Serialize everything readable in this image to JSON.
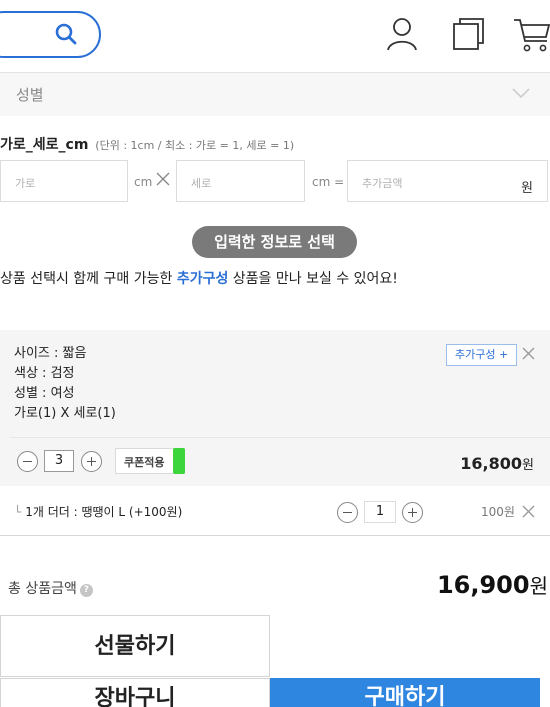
{
  "header": {
    "icons": [
      "search-icon",
      "user-icon",
      "recent-icon",
      "cart-icon"
    ]
  },
  "gender_select": {
    "label": "성별"
  },
  "size_input": {
    "title": "가로_세로_cm",
    "hint": "(단위 : 1cm / 최소 : 가로 = 1, 세로 = 1)",
    "width_placeholder": "가로",
    "height_placeholder": "세로",
    "unit_cm": "cm",
    "unit_cm_eq": "cm =",
    "price_placeholder": "추가금액",
    "won": "원"
  },
  "select_button": "입력한 정보로 선택",
  "notice": {
    "before": "상품 선택시 함께 구매 가능한 ",
    "accent": "추가구성",
    "after": " 상품을 만나 보실 수 있어요!"
  },
  "selected_option": {
    "lines": [
      "사이즈 : 짧음",
      "색상 : 검정",
      "성별 : 여성",
      "가로(1) X 세로(1)"
    ],
    "addon_badge": "추가구성 +",
    "quantity": "3",
    "coupon_label": "쿠폰적용",
    "price": "16,800",
    "price_unit": "원"
  },
  "addon_item": {
    "branch": "└",
    "name": "1개 더더 : 땡땡이 L (+100원)",
    "quantity": "1",
    "price": "100원"
  },
  "total": {
    "label": "총 상품금액",
    "help": "?",
    "price": "16,900",
    "unit": "원"
  },
  "buttons": {
    "gift": "선물하기",
    "cart": "장바구니",
    "buy": "구매하기"
  },
  "colors": {
    "accent": "#2a6fd6",
    "buy_button": "#2f86e0",
    "coupon_toggle": "#3cd53c"
  }
}
